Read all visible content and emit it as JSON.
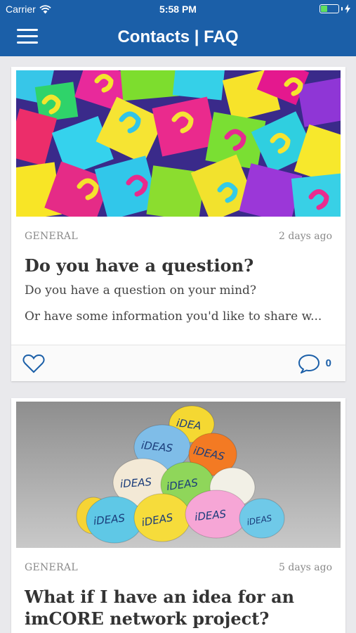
{
  "status": {
    "carrier": "Carrier",
    "time": "5:58 PM"
  },
  "nav": {
    "title": "Contacts | FAQ"
  },
  "posts": [
    {
      "category": "GENERAL",
      "age": "2 days ago",
      "title": "Do you have a question?",
      "snippet_1": "Do you have a question on your mind?",
      "snippet_2": "Or have some information you'd like to share w...",
      "comment_count": "0",
      "image": "colorful-question-mark-notes"
    },
    {
      "category": "GENERAL",
      "age": "5 days ago",
      "title": "What if I have an idea for an imCORE network project?",
      "image": "crumpled-paper-ideas-balls",
      "paper_label": "iDEAS",
      "top_paper_label": "iDEA"
    }
  ],
  "colors": {
    "header": "#1b5fa8",
    "background": "#e9e9ec",
    "accent": "#1b5fa8"
  }
}
